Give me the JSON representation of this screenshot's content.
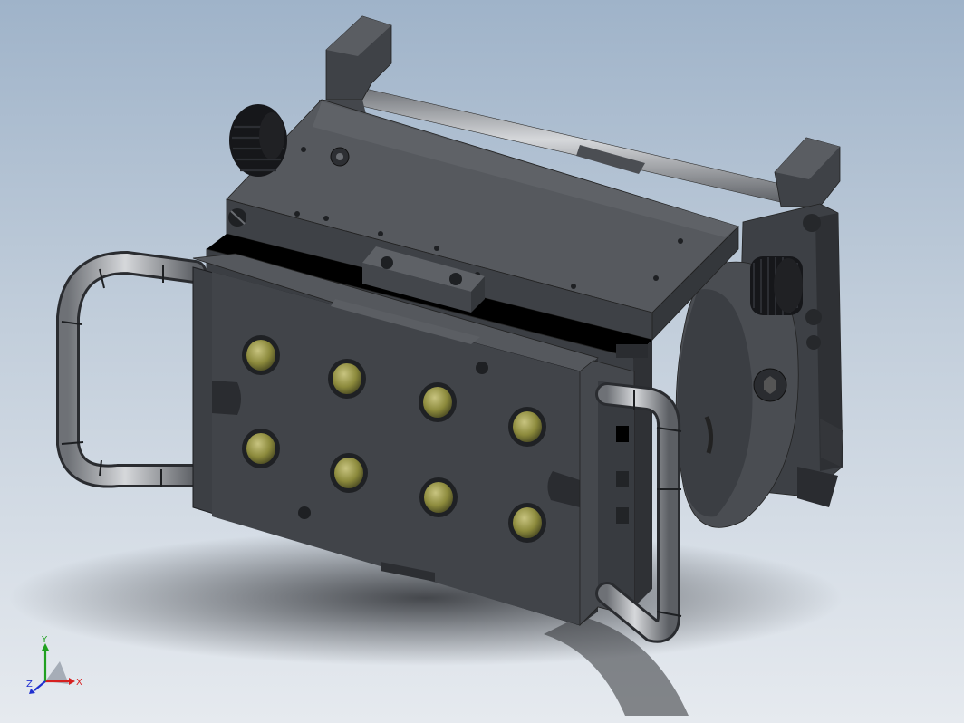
{
  "viewport": {
    "background_top": "#9fb3c9",
    "background_bottom": "#e6eaef"
  },
  "model": {
    "body_color": "#4a4d52",
    "face_color": "#3c3f44",
    "top_color": "#56595e",
    "handle_color": "#9a9da2",
    "lens_color": "#8c8a3c",
    "knob_color": "#16171a"
  },
  "triad": {
    "x_label": "X",
    "y_label": "Y",
    "z_label": "Z",
    "x_color": "#d62020",
    "y_color": "#20a020",
    "z_color": "#2030d0"
  }
}
